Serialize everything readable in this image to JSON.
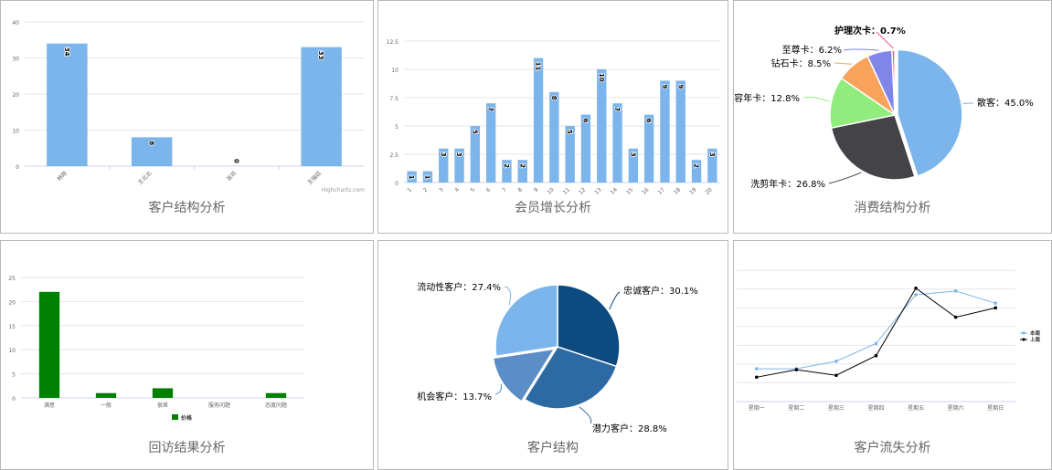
{
  "panels": [
    {
      "caption": "客户结构分析"
    },
    {
      "caption": "会员增长分析"
    },
    {
      "caption": "消费结构分析"
    },
    {
      "caption": "回访结果分析"
    },
    {
      "caption": "客户结构"
    },
    {
      "caption": "客户流失分析"
    }
  ],
  "credit": "Highcharts.com",
  "chart_data": [
    {
      "type": "bar",
      "categories": [
        "林刚",
        "王北北",
        "张司",
        "王瑞廷"
      ],
      "values": [
        34,
        8,
        0,
        33
      ],
      "ylim": [
        0,
        40
      ],
      "yticks": [
        0,
        10,
        20,
        30,
        40
      ],
      "color": "#7cb5ec",
      "title": "",
      "xlabel": "",
      "ylabel": ""
    },
    {
      "type": "bar",
      "categories": [
        "1",
        "2",
        "3",
        "4",
        "5",
        "6",
        "7",
        "8",
        "9",
        "10",
        "11",
        "12",
        "13",
        "14",
        "15",
        "16",
        "17",
        "18",
        "19",
        "20"
      ],
      "values": [
        1,
        1,
        3,
        3,
        5,
        7,
        2,
        2,
        11,
        8,
        5,
        6,
        10,
        7,
        3,
        6,
        9,
        9,
        2,
        3
      ],
      "ylim": [
        0,
        12.5
      ],
      "yticks": [
        0,
        2.5,
        5,
        7.5,
        10,
        12.5
      ],
      "color": "#7cb5ec",
      "title": "",
      "xlabel": "",
      "ylabel": ""
    },
    {
      "type": "pie",
      "slices": [
        {
          "name": "散客",
          "value": 45.0,
          "label": "45.0%",
          "color": "#7cb5ec"
        },
        {
          "name": "洗剪年卡",
          "value": 26.8,
          "label": "26.8%",
          "color": "#434348"
        },
        {
          "name": "美容年卡",
          "value": 12.8,
          "label": "12.8%",
          "color": "#90ed7d"
        },
        {
          "name": "钻石卡",
          "value": 8.5,
          "label": "8.5%",
          "color": "#f7a35c"
        },
        {
          "name": "至尊卡",
          "value": 6.2,
          "label": "6.2%",
          "color": "#8085e9"
        },
        {
          "name": "护理次卡",
          "value": 0.7,
          "label": "0.7%",
          "color": "#f15c80"
        }
      ]
    },
    {
      "type": "bar",
      "categories": [
        "满意",
        "一般",
        "很差",
        "服务问题",
        "态度问题"
      ],
      "values": [
        22,
        1,
        2,
        0,
        1
      ],
      "ylim": [
        0,
        25
      ],
      "yticks": [
        0,
        5,
        10,
        15,
        20,
        25
      ],
      "color": "#008000",
      "legend": [
        "价格"
      ],
      "title": "",
      "xlabel": "",
      "ylabel": ""
    },
    {
      "type": "pie",
      "slices": [
        {
          "name": "忠诚客户",
          "value": 30.1,
          "label": "30.1%",
          "color": "#0d4a7f"
        },
        {
          "name": "潜力客户",
          "value": 28.8,
          "label": "28.8%",
          "color": "#2d6aa3"
        },
        {
          "name": "机会客户",
          "value": 13.7,
          "label": "13.7%",
          "color": "#5b8ec6"
        },
        {
          "name": "流动性客户",
          "value": 27.4,
          "label": "27.4%",
          "color": "#7cb5ec"
        }
      ]
    },
    {
      "type": "line",
      "categories": [
        "星期一",
        "星期二",
        "星期三",
        "星期四",
        "星期五",
        "星期六",
        "星期日"
      ],
      "series": [
        {
          "name": "本周",
          "values": [
            3.5,
            3.5,
            4.3,
            6.2,
            11.4,
            11.8,
            10.5
          ],
          "color": "#7cb5ec"
        },
        {
          "name": "上周",
          "values": [
            2.6,
            3.4,
            2.8,
            4.9,
            12.1,
            9.0,
            10.0
          ],
          "color": "#000000"
        }
      ],
      "ylim": [
        0,
        15
      ],
      "legend_position": "right"
    }
  ]
}
